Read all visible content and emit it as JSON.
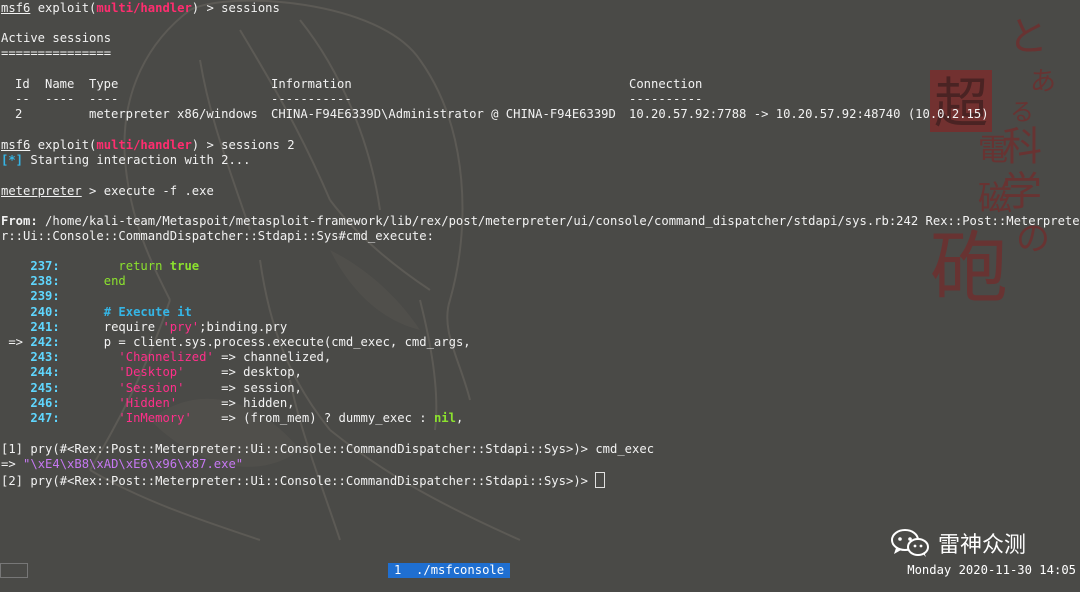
{
  "terminal": {
    "prompt_user": "msf6",
    "prompt_mid": " exploit(",
    "prompt_module": "multi/handler",
    "prompt_end": ") > ",
    "cmd_sessions": "sessions",
    "active_title": "Active sessions",
    "active_rule": "===============",
    "table": {
      "headers": [
        "Id",
        "Name",
        "Type",
        "Information",
        "Connection"
      ],
      "underlines": [
        "--",
        "----",
        "----",
        "-----------",
        "----------"
      ],
      "row": [
        "2",
        "",
        "meterpreter x86/windows",
        "CHINA-F94E6339D\\Administrator @ CHINA-F94E6339D",
        "10.20.57.92:7788 -> 10.20.57.92:48740 (10.0.2.15)"
      ]
    },
    "cmd_sessions2": "sessions 2",
    "star_bracket": "[*]",
    "starting": " Starting interaction with 2...",
    "meterpreter": "meterpreter",
    "mp_cmd": " > execute -f .exe",
    "from_label": "From:",
    "from_path": " /home/kali-team/Metaspoit/metasploit-framework/lib/rex/post/meterpreter/ui/console/command_dispatcher/stdapi/sys.rb:242 Rex::Post::Meterprete",
    "from_path2": "r::Ui::Console::CommandDispatcher::Stdapi::Sys#cmd_execute:",
    "code": [
      {
        "arrow": "    ",
        "num": "237",
        "pre": "        ",
        "kw": "return",
        "mid": " ",
        "kw2": "true",
        "rest": "",
        "str": "",
        "rest2": ""
      },
      {
        "arrow": "    ",
        "num": "238",
        "pre": "      ",
        "kw": "end",
        "mid": "",
        "kw2": "",
        "rest": "",
        "str": "",
        "rest2": ""
      },
      {
        "arrow": "    ",
        "num": "239",
        "pre": "",
        "kw": "",
        "mid": "",
        "kw2": "",
        "rest": "",
        "str": "",
        "rest2": ""
      },
      {
        "arrow": "    ",
        "num": "240",
        "pre": "      ",
        "kw": "",
        "mid": "",
        "kw2": "",
        "rest": "",
        "comment": "# Execute it",
        "str": "",
        "rest2": ""
      },
      {
        "arrow": "    ",
        "num": "241",
        "pre": "      ",
        "kw": "",
        "mid": "",
        "kw2": "",
        "rest": "require ",
        "str": "'pry'",
        "rest2": ";binding.pry"
      },
      {
        "arrow": " => ",
        "num": "242",
        "pre": "      ",
        "kw": "",
        "mid": "",
        "kw2": "",
        "rest": "p = client.sys.process.execute(cmd_exec, cmd_args,",
        "str": "",
        "rest2": ""
      },
      {
        "arrow": "    ",
        "num": "243",
        "pre": "        ",
        "kw": "",
        "mid": "",
        "kw2": "",
        "rest": "",
        "str": "'Channelized'",
        "rest2": " => channelized,"
      },
      {
        "arrow": "    ",
        "num": "244",
        "pre": "        ",
        "kw": "",
        "mid": "",
        "kw2": "",
        "rest": "",
        "str": "'Desktop'",
        "rest2": "     => desktop,"
      },
      {
        "arrow": "    ",
        "num": "245",
        "pre": "        ",
        "kw": "",
        "mid": "",
        "kw2": "",
        "rest": "",
        "str": "'Session'",
        "rest2": "     => session,"
      },
      {
        "arrow": "    ",
        "num": "246",
        "pre": "        ",
        "kw": "",
        "mid": "",
        "kw2": "",
        "rest": "",
        "str": "'Hidden'",
        "rest2": "      => hidden,"
      },
      {
        "arrow": "    ",
        "num": "247",
        "pre": "        ",
        "kw": "",
        "mid": "",
        "kw2": "",
        "rest": "",
        "str": "'InMemory'",
        "rest2": "    => (from_mem) ? dummy_exec : ",
        "kw3": "nil",
        "rest3": ","
      }
    ],
    "pry1": "[1] pry(#<Rex::Post::Meterpreter::Ui::Console::CommandDispatcher::Stdapi::Sys>)> cmd_exec",
    "result_arrow": "=> ",
    "result_value": "\"\\xE4\\xB8\\xAD\\xE6\\x96\\x87.exe\"",
    "pry2": "[2] pry(#<Rex::Post::Meterpreter::Ui::Console::CommandDispatcher::Stdapi::Sys>)> "
  },
  "status": {
    "tab_index": "1",
    "tab_name": "./msfconsole",
    "clock": "Monday 2020-11-30 14:05"
  },
  "watermark": [
    "と",
    "あ",
    "る",
    "科",
    "学",
    "の",
    "超",
    "電",
    "磁",
    "砲"
  ],
  "brand": {
    "name": "雷神众测",
    "icon": "wechat-icon"
  },
  "colors": {
    "background": "#4a4a47",
    "prompt_module": "#ff2d6f",
    "line_numbers": "#5fd7ff",
    "keyword": "#8be22e",
    "string": "#ff2f8a",
    "result": "#c678f2",
    "status_tab": "#1f6fd1"
  }
}
